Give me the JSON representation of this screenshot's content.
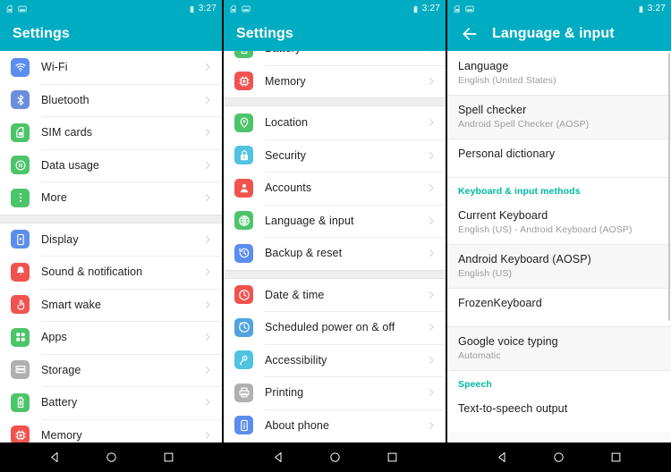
{
  "status_bar": {
    "icons": [
      "sim-card-icon",
      "screenshot-icon"
    ],
    "battery_icon": "battery-icon",
    "time": "3:27"
  },
  "colors": {
    "app_bar": "#00acc1",
    "section_header": "#00b8a0",
    "panel_bg": "#fafafa",
    "row_bg": "#ffffff",
    "nav_bar": "#000000"
  },
  "panel1": {
    "title": "Settings",
    "groups": [
      {
        "items": [
          {
            "label": "Wi-Fi",
            "icon": "wifi-icon",
            "color": "#5b8def"
          },
          {
            "label": "Bluetooth",
            "icon": "bluetooth-icon",
            "color": "#6a8edb"
          },
          {
            "label": "SIM cards",
            "icon": "sim-card-icon",
            "color": "#4cc46a"
          },
          {
            "label": "Data usage",
            "icon": "data-usage-icon",
            "color": "#4cc46a"
          },
          {
            "label": "More",
            "icon": "more-dots-icon",
            "color": "#4cc46a"
          }
        ]
      },
      {
        "items": [
          {
            "label": "Display",
            "icon": "display-icon",
            "color": "#5b8def"
          },
          {
            "label": "Sound & notification",
            "icon": "bell-icon",
            "color": "#f0534f"
          },
          {
            "label": "Smart wake",
            "icon": "smart-wake-icon",
            "color": "#f0534f"
          },
          {
            "label": "Apps",
            "icon": "apps-grid-icon",
            "color": "#4cc46a"
          },
          {
            "label": "Storage",
            "icon": "storage-icon",
            "color": "#b0b0b0"
          },
          {
            "label": "Battery",
            "icon": "battery-icon",
            "color": "#4cc46a"
          },
          {
            "label": "Memory",
            "icon": "memory-chip-icon",
            "color": "#f0534f"
          }
        ]
      }
    ]
  },
  "panel2": {
    "title": "Settings",
    "groups": [
      {
        "items": [
          {
            "label": "Battery",
            "icon": "battery-icon",
            "color": "#4cc46a"
          },
          {
            "label": "Memory",
            "icon": "memory-chip-icon",
            "color": "#f0534f"
          }
        ]
      },
      {
        "items": [
          {
            "label": "Location",
            "icon": "location-pin-icon",
            "color": "#4cc46a"
          },
          {
            "label": "Security",
            "icon": "lock-icon",
            "color": "#4fc3e0"
          },
          {
            "label": "Accounts",
            "icon": "account-icon",
            "color": "#f0534f"
          },
          {
            "label": "Language & input",
            "icon": "globe-icon",
            "color": "#4cc46a"
          },
          {
            "label": "Backup & reset",
            "icon": "backup-restore-icon",
            "color": "#5b8def"
          }
        ]
      },
      {
        "items": [
          {
            "label": "Date & time",
            "icon": "clock-icon",
            "color": "#f0534f"
          },
          {
            "label": "Scheduled power on & off",
            "icon": "scheduled-power-icon",
            "color": "#4fa3e0"
          },
          {
            "label": "Accessibility",
            "icon": "accessibility-icon",
            "color": "#4fc3e0"
          },
          {
            "label": "Printing",
            "icon": "printer-icon",
            "color": "#b0b0b0"
          },
          {
            "label": "About phone",
            "icon": "info-icon",
            "color": "#5b8def"
          }
        ]
      }
    ]
  },
  "panel3": {
    "title": "Language & input",
    "back_icon": "back-arrow-icon",
    "rows": [
      {
        "type": "item",
        "title": "Language",
        "subtitle": "English (United States)"
      },
      {
        "type": "item",
        "title": "Spell checker",
        "subtitle": "Android Spell Checker (AOSP)"
      },
      {
        "type": "item",
        "title": "Personal dictionary",
        "subtitle": ""
      },
      {
        "type": "header",
        "title": "Keyboard & input methods"
      },
      {
        "type": "item",
        "title": "Current Keyboard",
        "subtitle": "English (US) - Android Keyboard (AOSP)"
      },
      {
        "type": "item",
        "title": "Android Keyboard (AOSP)",
        "subtitle": "English (US)"
      },
      {
        "type": "item",
        "title": "FrozenKeyboard",
        "subtitle": ""
      },
      {
        "type": "item",
        "title": "Google voice typing",
        "subtitle": "Automatic"
      },
      {
        "type": "header",
        "title": "Speech"
      },
      {
        "type": "item",
        "title": "Text-to-speech output",
        "subtitle": ""
      }
    ]
  },
  "nav_bar": {
    "buttons": [
      "back-nav-icon",
      "home-nav-icon",
      "recents-nav-icon"
    ]
  }
}
